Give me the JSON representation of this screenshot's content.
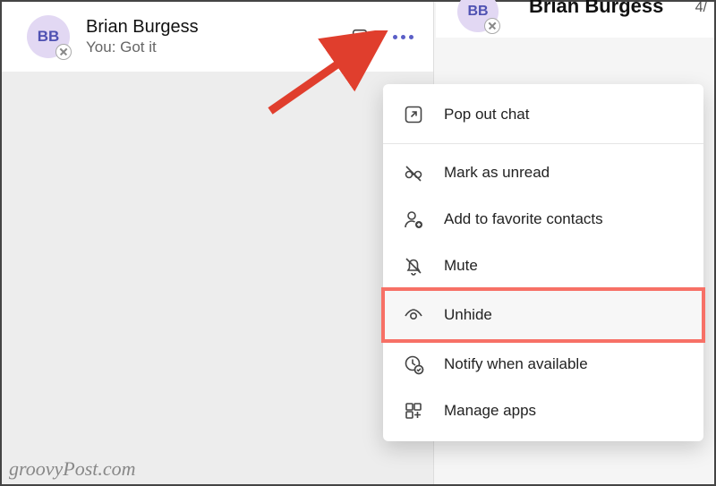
{
  "chat_item": {
    "avatar_initials": "BB",
    "name": "Brian Burgess",
    "preview": "You: Got it"
  },
  "right_panel": {
    "avatar_initials": "BB",
    "name": "Brian Burgess",
    "date_fragment": "4/"
  },
  "menu": {
    "pop_out": "Pop out chat",
    "mark_unread": "Mark as unread",
    "add_favorite": "Add to favorite contacts",
    "mute": "Mute",
    "unhide": "Unhide",
    "notify": "Notify when available",
    "manage_apps": "Manage apps"
  },
  "watermark": "groovyPost.com"
}
